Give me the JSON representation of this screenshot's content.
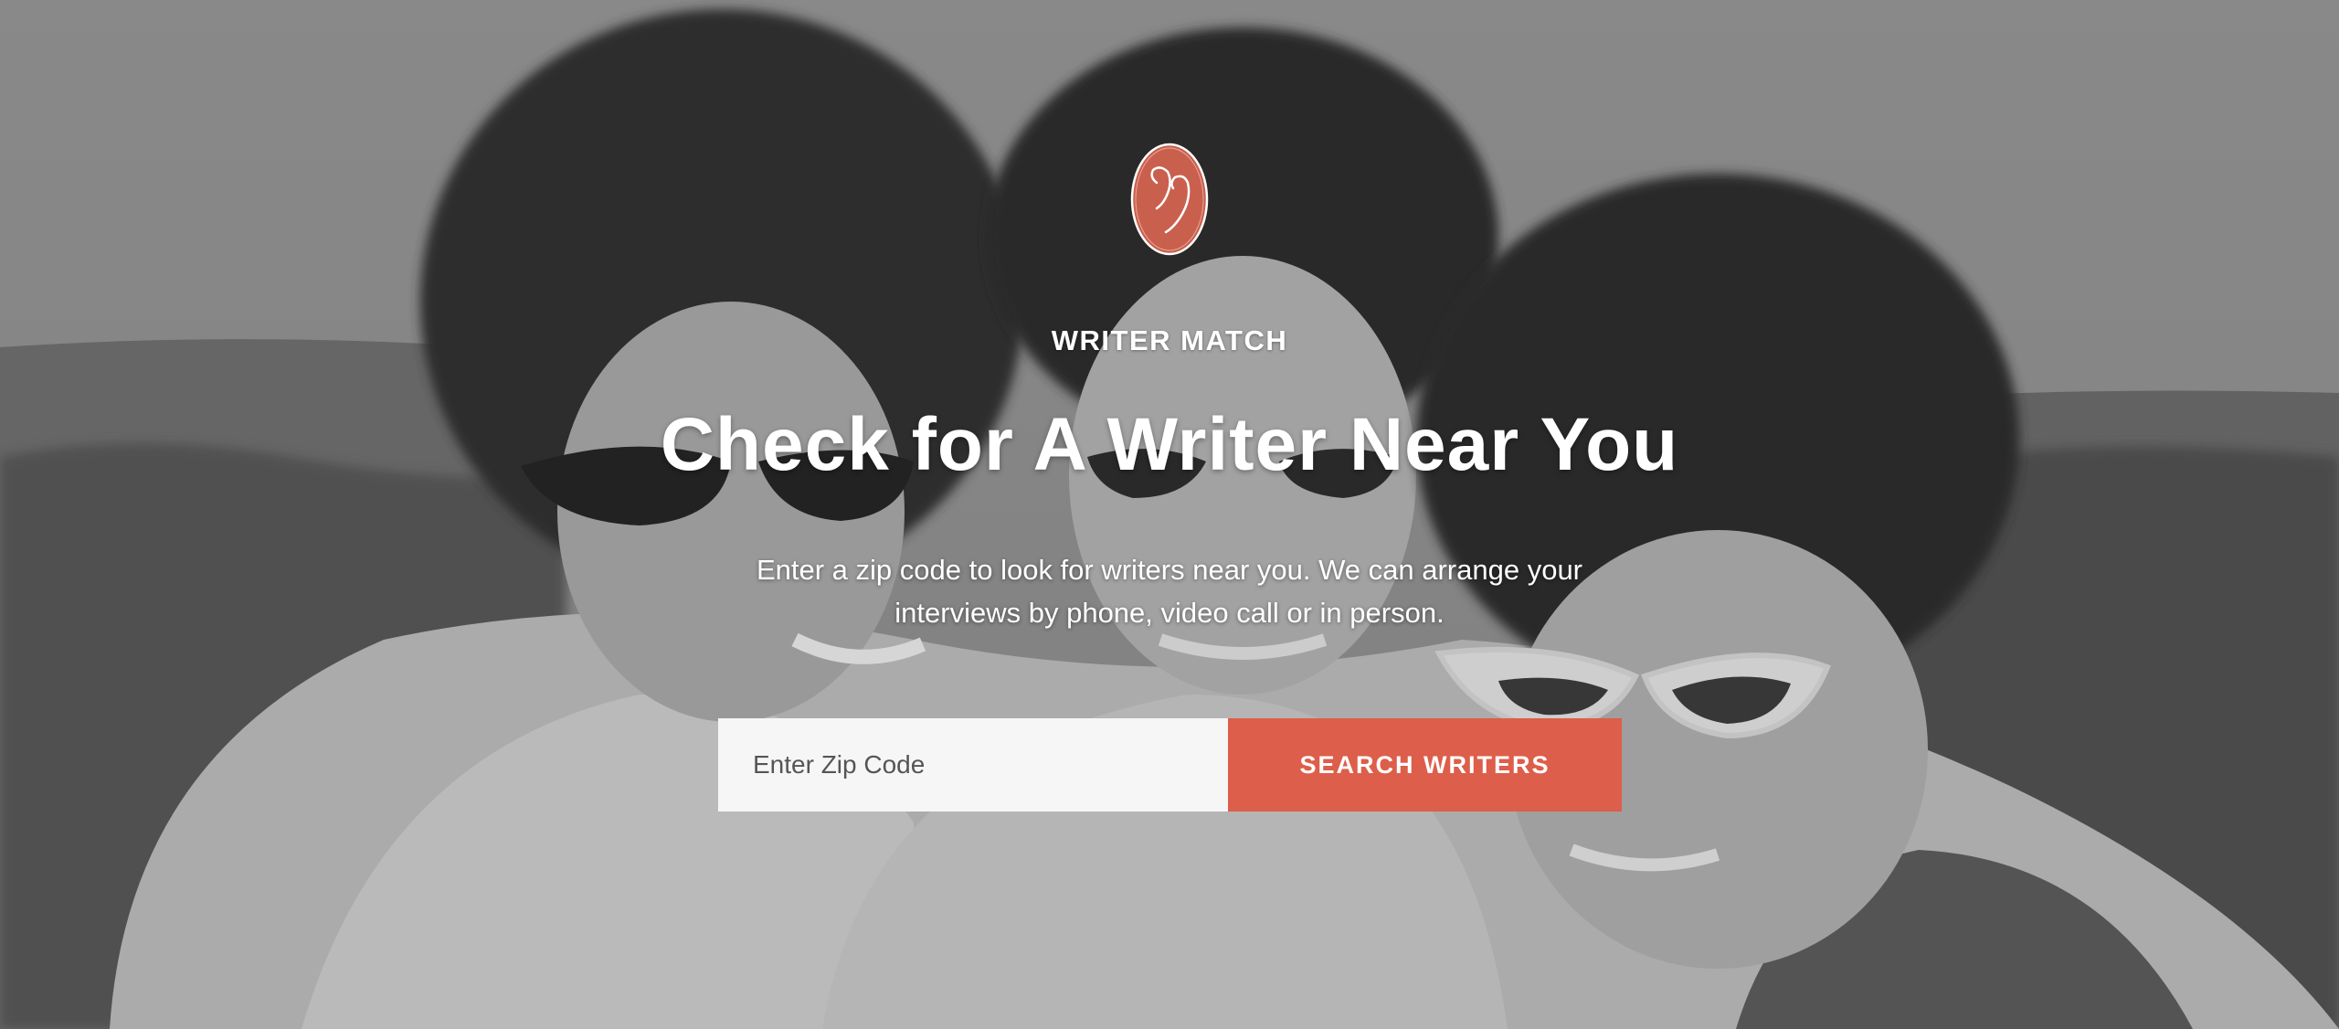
{
  "brand": {
    "logo_icon": "quote-mark-icon",
    "logo_color": "#c9604e"
  },
  "hero": {
    "eyebrow": "WRITER MATCH",
    "headline": "Check for A Writer Near You",
    "subtext_line1": "Enter a zip code to look for writers near you. We can arrange your",
    "subtext_line2": "interviews by phone, video call or in person.",
    "background_image": "black-and-white-photo-three-people-icon"
  },
  "search": {
    "zip_placeholder": "Enter Zip Code",
    "zip_value": "",
    "button_label": "SEARCH WRITERS",
    "button_color": "#dd5e4a"
  }
}
